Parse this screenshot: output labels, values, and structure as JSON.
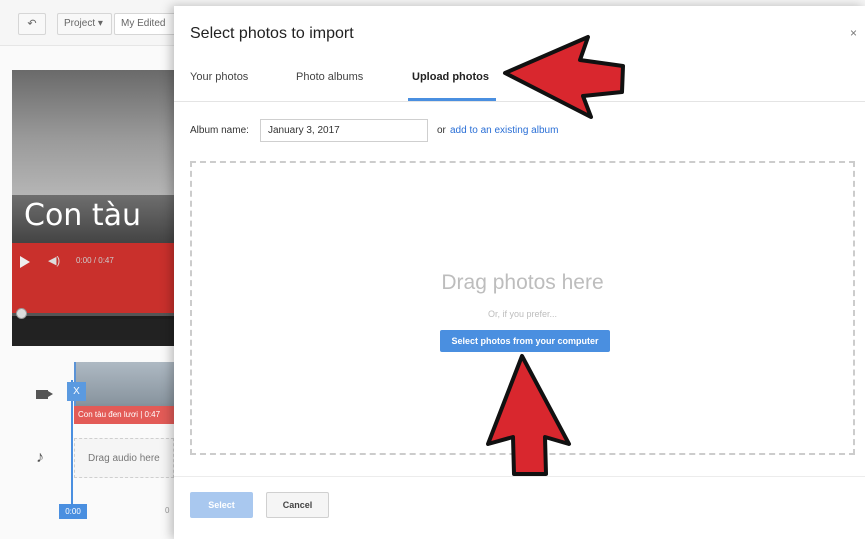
{
  "editor": {
    "undo_icon": "undo-arrow-icon",
    "project_menu_label": "Project ▾",
    "project_title": "My Edited",
    "preview": {
      "caption": "Con tàu",
      "time": "0:00 / 0:47",
      "play_icon": "play-icon",
      "volume_icon": "volume-icon"
    },
    "timeline": {
      "clip_handle": "X",
      "clip_label": "Con tàu đen lươi | 0:47",
      "audio_placeholder": "Drag audio here",
      "playhead_time": "0:00",
      "ruler_zero": "0"
    }
  },
  "dialog": {
    "title": "Select photos to import",
    "close_icon": "×",
    "tabs": [
      {
        "label": "Your photos"
      },
      {
        "label": "Photo albums"
      },
      {
        "label": "Upload photos",
        "active": true
      }
    ],
    "album": {
      "label": "Album name:",
      "value": "January 3, 2017",
      "or_text": "or",
      "link_text": "add to an existing album"
    },
    "drop_zone": {
      "title": "Drag photos here",
      "subtitle": "Or, if you prefer...",
      "button_label": "Select photos from your computer"
    },
    "footer": {
      "select_label": "Select",
      "cancel_label": "Cancel"
    }
  },
  "colors": {
    "accent": "#4a8fe0",
    "link": "#2a6fd6",
    "arrow_fill": "#d9272e",
    "arrow_stroke": "#111111",
    "caption_band": "#c9302c"
  }
}
